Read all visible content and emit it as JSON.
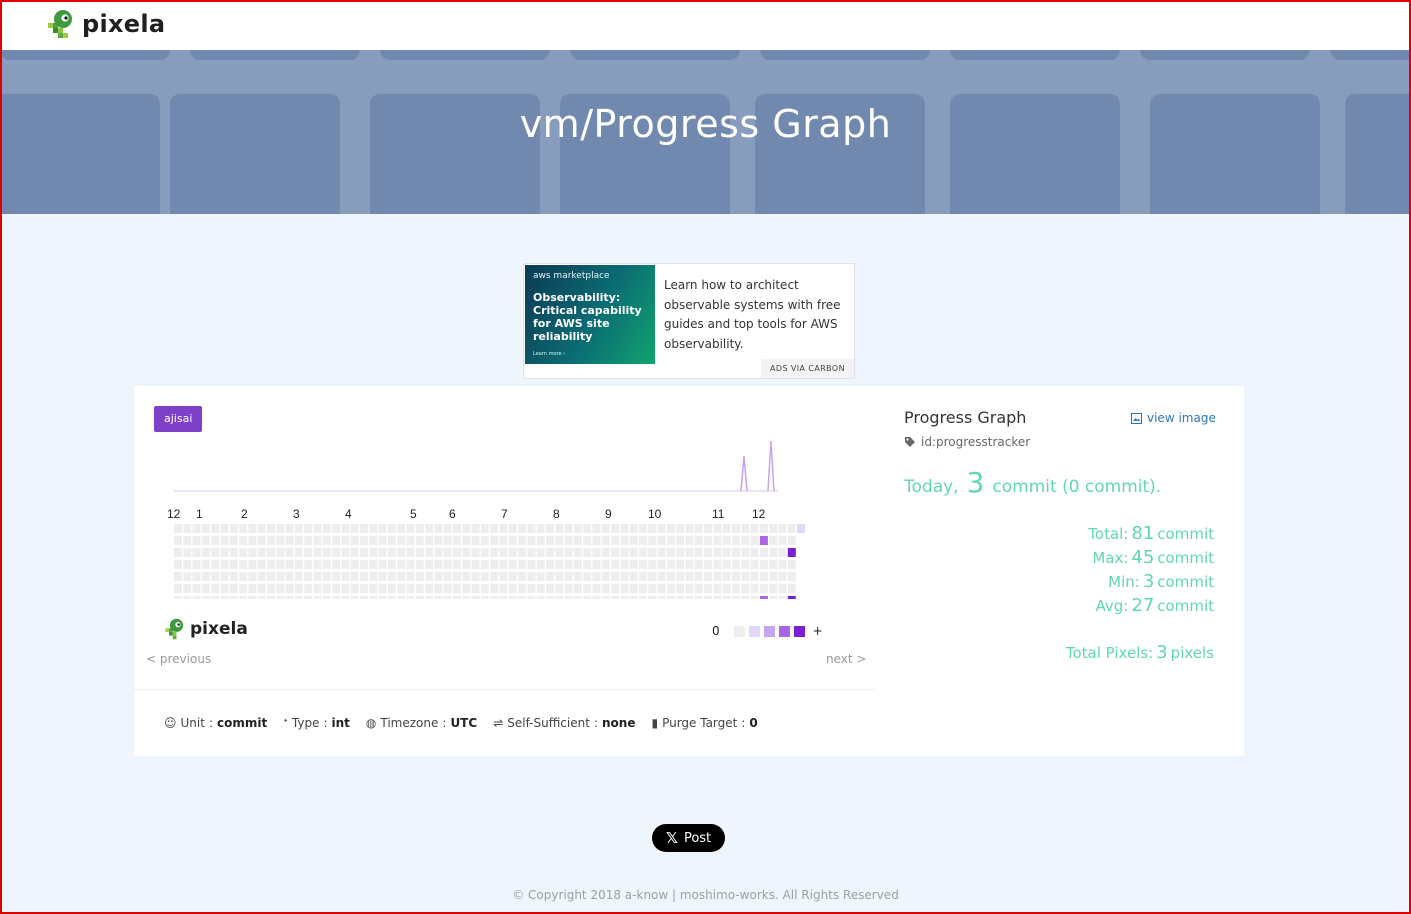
{
  "brand": {
    "name": "pixela"
  },
  "hero": {
    "title": "vm/Progress Graph"
  },
  "ad": {
    "image_brand": "aws marketplace",
    "image_headline": "Observability: Critical capability for AWS site reliability",
    "image_cta": "Learn more ›",
    "text": "Learn how to architect observable systems with free guides and top tools for AWS observability.",
    "via": "ADS VIA CARBON"
  },
  "graph": {
    "theme_badge": "ajisai",
    "months": [
      "12",
      "1",
      "2",
      "3",
      "4",
      "5",
      "6",
      "7",
      "8",
      "9",
      "10",
      "11",
      "12"
    ],
    "legend_low": "0",
    "legend_high": "+",
    "prev": "< previous",
    "next": "next >",
    "colors": {
      "empty": "#eeeeee",
      "l1": "#e1d7f6",
      "l2": "#c5a5ee",
      "l3": "#a966e6",
      "l4": "#7a1fd6",
      "line": "#d7c5f4"
    }
  },
  "meta": {
    "unit_label": "Unit",
    "unit_value": "commit",
    "type_label": "Type",
    "type_value": "int",
    "timezone_label": "Timezone",
    "timezone_value": "UTC",
    "self_label": "Self-Sufficient",
    "self_value": "none",
    "purge_label": "Purge Target",
    "purge_value": "0",
    "sep": ":"
  },
  "info": {
    "title": "Progress Graph",
    "view_image": "view image",
    "id": "id:progresstracker",
    "today_label": "Today,",
    "today_value": "3",
    "today_unit": "commit (0 commit).",
    "total_label": "Total:",
    "total_value": "81",
    "max_label": "Max:",
    "max_value": "45",
    "min_label": "Min:",
    "min_value": "3",
    "avg_label": "Avg:",
    "avg_value": "27",
    "unit": "commit",
    "pixels_label": "Total Pixels:",
    "pixels_value": "3",
    "pixels_unit": "pixels"
  },
  "post": {
    "label": "Post"
  },
  "footer": {
    "text": "© Copyright 2018 a-know | moshimo-works. All Rights Reserved"
  }
}
